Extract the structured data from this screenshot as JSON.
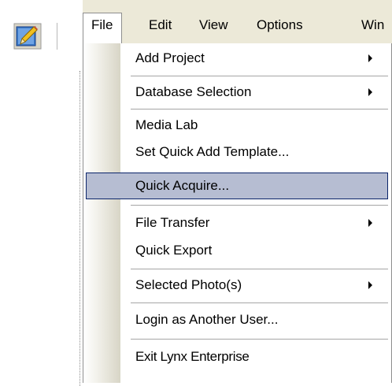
{
  "menubar": {
    "items": [
      {
        "label": "File"
      },
      {
        "label": "Edit"
      },
      {
        "label": "View"
      },
      {
        "label": "Options"
      },
      {
        "label": "Win"
      }
    ]
  },
  "toolbar": {
    "icon": "pencil-notepad-icon"
  },
  "file_menu": {
    "items": [
      {
        "label": "Add Project",
        "has_submenu": true
      },
      {
        "label": "Database Selection",
        "has_submenu": true
      },
      {
        "label": "Media Lab"
      },
      {
        "label": "Set Quick Add Template..."
      },
      {
        "label": "Quick Acquire...",
        "highlighted": true
      },
      {
        "label": "File Transfer",
        "has_submenu": true
      },
      {
        "label": "Quick Export"
      },
      {
        "label": "Selected Photo(s)",
        "has_submenu": true
      },
      {
        "label": "Login as Another User..."
      },
      {
        "label": "Exit Lynx Enterprise"
      }
    ]
  },
  "colors": {
    "menubar_bg": "#ece9d8",
    "highlight_bg": "#b6bdd2",
    "highlight_border": "#0a246a"
  }
}
